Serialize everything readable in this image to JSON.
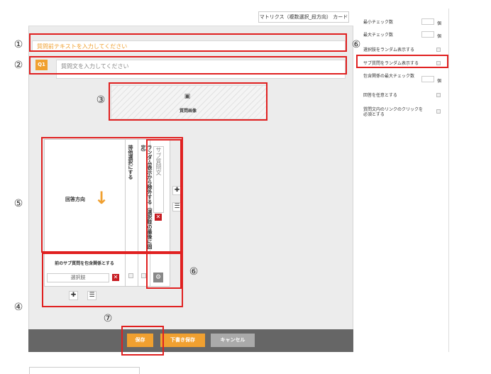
{
  "header": {
    "card_type": "マトリクス（複数選択_段方向） カード"
  },
  "question": {
    "pre_text_placeholder": "質問前テキストを入力してください",
    "badge": "Q1",
    "text_placeholder": "質問文を入力してください",
    "image_label": "質問画像"
  },
  "matrix": {
    "direction_label": "回答方向",
    "direction_arrow": "↓",
    "col1_header": "排他選択にする",
    "col2_header": "ランダム表示から除外する（選択肢の最後に固定）",
    "sub_question_placeholder": "サブ質問文",
    "sub_relation_label": "前のサブ質問を包含関係とする",
    "choice_placeholder": "選択肢"
  },
  "icons": {
    "close": "close-icon",
    "add": "plus-icon",
    "list": "list-icon",
    "settings": "gear-icon",
    "image": "image-icon"
  },
  "footer": {
    "save": "保存",
    "draft": "下書き保存",
    "cancel": "キャンセル"
  },
  "settings": {
    "min_check": "最小チェック数",
    "max_check": "最大チェック数",
    "unit": "個",
    "random_choices": "選択肢をランダム表示する",
    "random_sub": "サブ質問をランダム表示する",
    "inclusion_max": "包含関係の最大チェック数",
    "optional_answer": "回答を任意とする",
    "require_link": "質問文内のリンクのクリックを必須とする"
  },
  "annotations": [
    "①",
    "②",
    "③",
    "④",
    "⑤",
    "⑥",
    "⑥",
    "⑦"
  ],
  "colors": {
    "accent": "#f0a030",
    "highlight": "#e02020",
    "close": "#c71c22",
    "footer": "#666666"
  }
}
